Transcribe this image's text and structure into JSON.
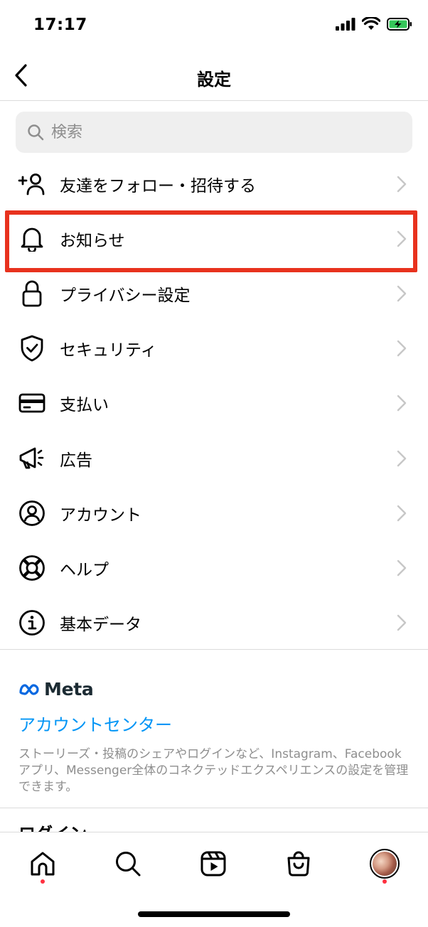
{
  "status_bar": {
    "time": "17:17"
  },
  "nav": {
    "title": "設定"
  },
  "search": {
    "placeholder": "検索"
  },
  "menu": [
    {
      "label": "友達をフォロー・招待する",
      "icon": "add-person-icon"
    },
    {
      "label": "お知らせ",
      "icon": "bell-icon"
    },
    {
      "label": "プライバシー設定",
      "icon": "lock-icon"
    },
    {
      "label": "セキュリティ",
      "icon": "shield-check-icon"
    },
    {
      "label": "支払い",
      "icon": "credit-card-icon"
    },
    {
      "label": "広告",
      "icon": "megaphone-icon"
    },
    {
      "label": "アカウント",
      "icon": "account-circle-icon"
    },
    {
      "label": "ヘルプ",
      "icon": "lifebuoy-icon"
    },
    {
      "label": "基本データ",
      "icon": "info-icon"
    }
  ],
  "meta": {
    "brand": "Meta",
    "account_center": "アカウントセンター",
    "description": "ストーリーズ・投稿のシェアやログインなど、Instagram、Facebookアプリ、Messenger全体のコネクテッドエクスペリエンスの設定を管理できます。"
  },
  "login_section_peek": "ログイン",
  "colors": {
    "accent": "#0095f6",
    "highlight": "#e8321e",
    "notification_dot": "#ff3040"
  },
  "tabs": [
    "home-icon",
    "search-icon",
    "reels-icon",
    "shop-icon",
    "profile-avatar"
  ]
}
